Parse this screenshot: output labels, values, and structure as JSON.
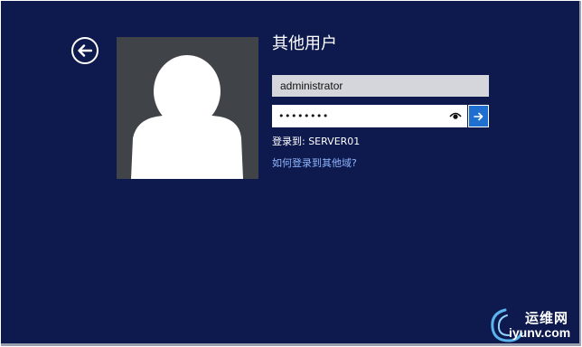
{
  "page": {
    "title": "其他用户"
  },
  "form": {
    "username": "administrator",
    "password_mask": "••••••••",
    "signin_to": "登录到: SERVER01",
    "other_domain_link": "如何登录到其他域?"
  },
  "icons": {
    "back": "back-arrow-icon",
    "avatar": "user-silhouette-icon",
    "reveal": "eye-icon",
    "submit": "right-arrow-icon"
  },
  "watermark": {
    "cn": "运维网",
    "en": "iyunv.com"
  },
  "colors": {
    "background": "#0e1a4d",
    "avatar_bg": "#404448",
    "submit": "#1f6fd0",
    "link": "#8fb6ff"
  }
}
